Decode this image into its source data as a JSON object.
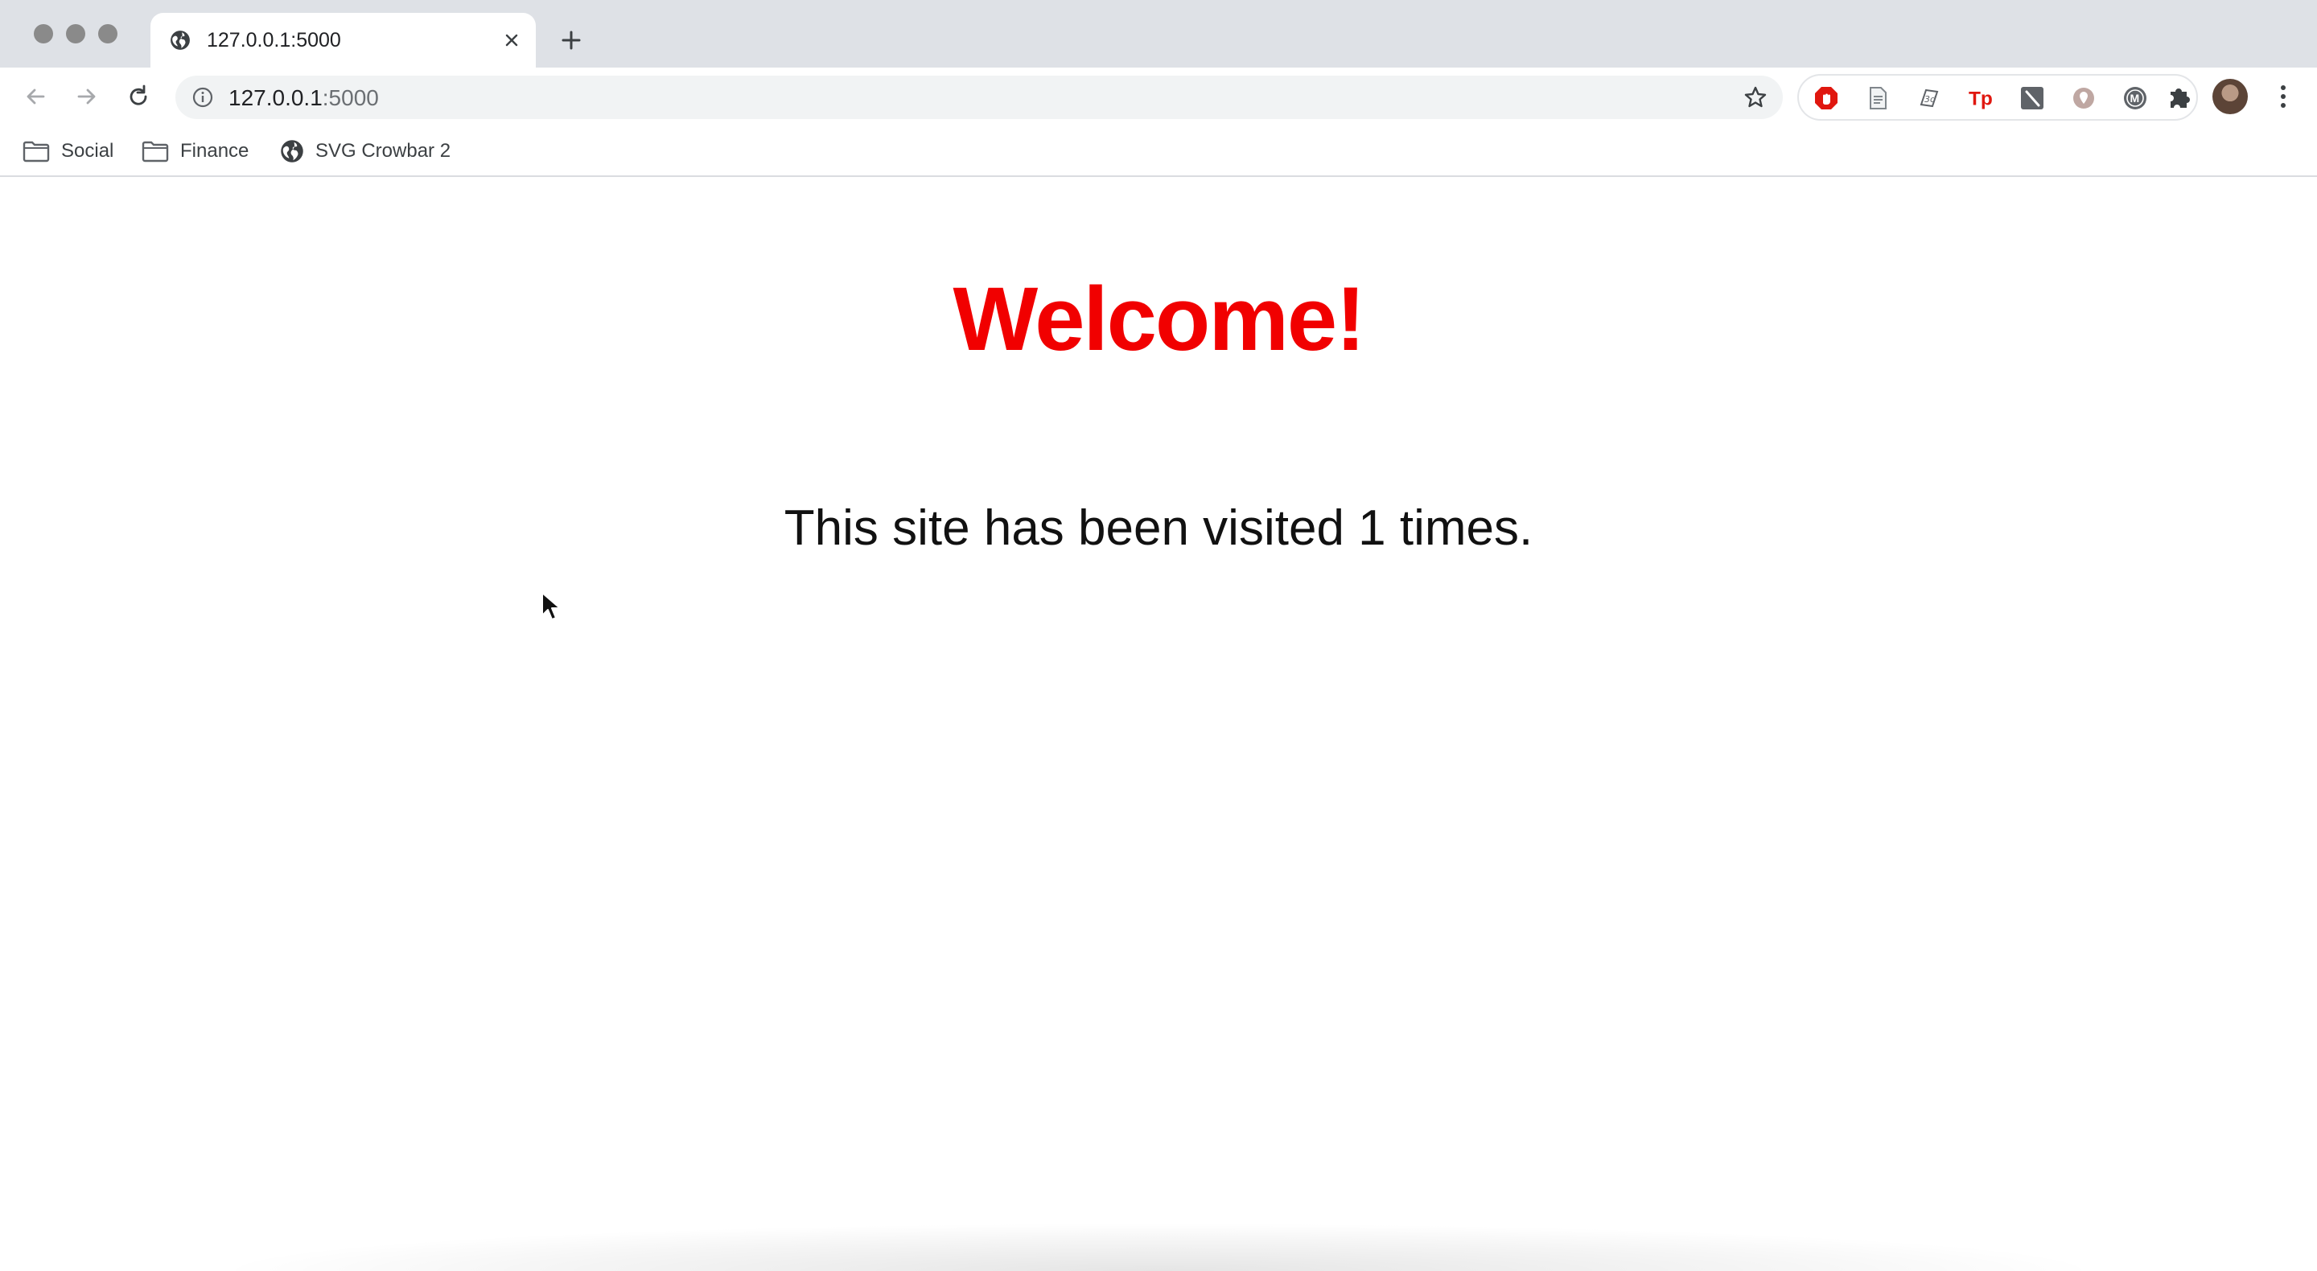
{
  "browser": {
    "tab": {
      "title": "127.0.0.1:5000",
      "favicon": "globe-icon"
    },
    "address_bar": {
      "host": "127.0.0.1",
      "port": ":5000"
    },
    "extensions": [
      "adblock-icon",
      "document-icon",
      "3d-model-icon",
      "tp-icon",
      "pen-icon",
      "location-pin-icon",
      "m-icon"
    ],
    "bookmarks": [
      {
        "label": "Social",
        "icon": "folder-icon"
      },
      {
        "label": "Finance",
        "icon": "folder-icon"
      },
      {
        "label": "SVG Crowbar 2",
        "icon": "globe-icon"
      }
    ]
  },
  "page": {
    "heading": "Welcome!",
    "visits_text": "This site has been visited 1 times."
  },
  "colors": {
    "heading": "#f10000",
    "tabstrip": "#dee1e6",
    "omnibox": "#f1f3f4"
  }
}
